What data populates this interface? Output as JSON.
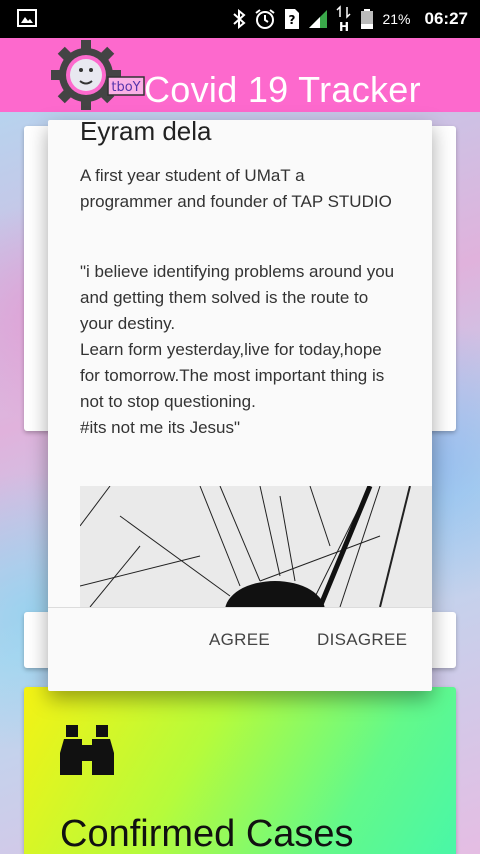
{
  "status_bar": {
    "battery_percent": "21%",
    "time": "06:27",
    "network": "H",
    "icons": [
      "image-icon",
      "bluetooth-icon",
      "alarm-icon",
      "sim-unknown-icon",
      "signal-icon",
      "data-arrows-icon",
      "battery-icon"
    ]
  },
  "app_bar": {
    "title": "Covid 19 Tracker",
    "logo_text": "tboY",
    "background": "#fd69cd"
  },
  "dialog": {
    "name": "Eyram dela",
    "bio": "A first year student of UMaT a programmer and founder of TAP STUDIO",
    "quote_lines": [
      "\"i believe identifying problems around you and getting them solved is the route to your destiny.",
      "Learn form yesterday,live for today,hope for tomorrow.The most important thing is not to stop questioning.",
      "#its not me its Jesus\""
    ],
    "agree_label": "AGREE",
    "disagree_label": "DISAGREE"
  },
  "cards": {
    "confirmed_title": "Confirmed Cases",
    "confirmed_icon": "binoculars-icon"
  }
}
